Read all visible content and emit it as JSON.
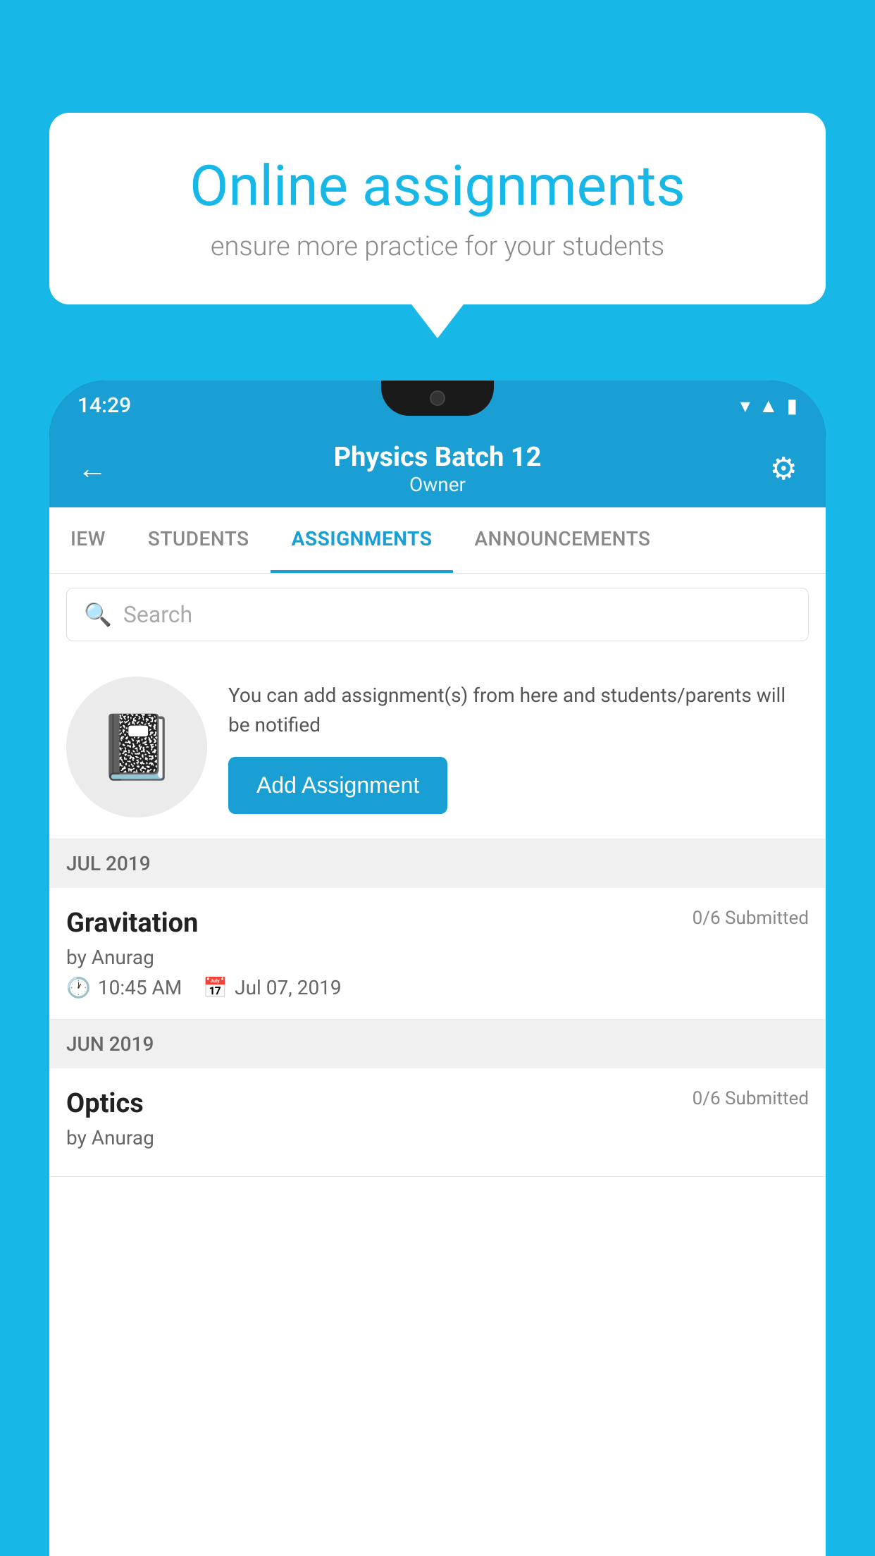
{
  "background": {
    "color": "#17b8e8"
  },
  "speech_bubble": {
    "title": "Online assignments",
    "subtitle": "ensure more practice for your students"
  },
  "status_bar": {
    "time": "14:29",
    "icons": [
      "wifi",
      "signal",
      "battery"
    ]
  },
  "app_header": {
    "batch_name": "Physics Batch 12",
    "role": "Owner",
    "back_label": "←",
    "settings_label": "⚙"
  },
  "tabs": [
    {
      "label": "IEW",
      "active": false
    },
    {
      "label": "STUDENTS",
      "active": false
    },
    {
      "label": "ASSIGNMENTS",
      "active": true
    },
    {
      "label": "ANNOUNCEMENTS",
      "active": false
    }
  ],
  "search": {
    "placeholder": "Search"
  },
  "promo": {
    "text": "You can add assignment(s) from here and students/parents will be notified",
    "button_label": "Add Assignment"
  },
  "sections": [
    {
      "header": "JUL 2019",
      "assignments": [
        {
          "name": "Gravitation",
          "submitted": "0/6 Submitted",
          "by": "by Anurag",
          "time": "10:45 AM",
          "date": "Jul 07, 2019"
        }
      ]
    },
    {
      "header": "JUN 2019",
      "assignments": [
        {
          "name": "Optics",
          "submitted": "0/6 Submitted",
          "by": "by Anurag",
          "time": "",
          "date": ""
        }
      ]
    }
  ]
}
